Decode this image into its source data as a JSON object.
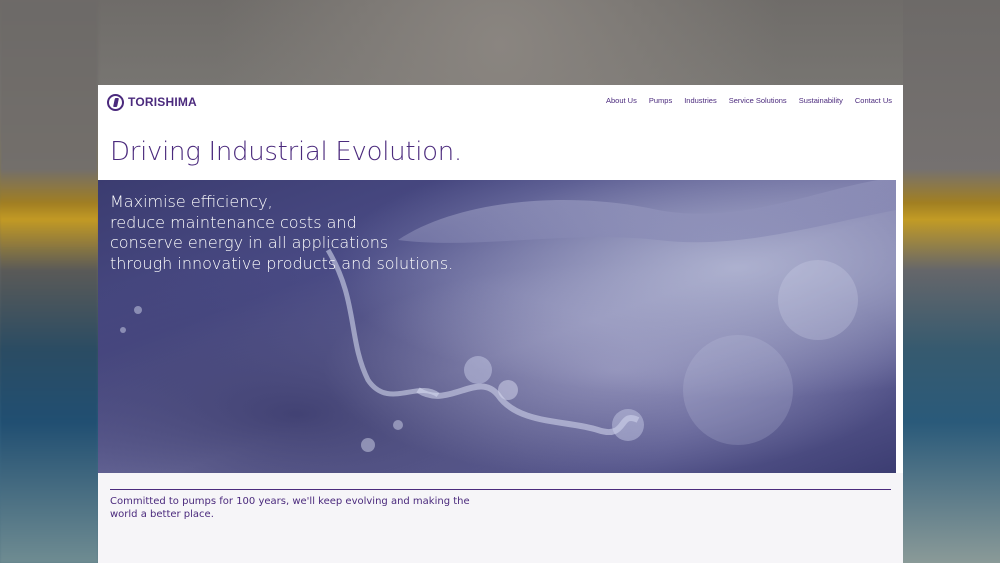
{
  "header": {
    "logo_text": "TORISHIMA",
    "nav": [
      {
        "label": "About Us"
      },
      {
        "label": "Pumps"
      },
      {
        "label": "Industries"
      },
      {
        "label": "Service Solutions"
      },
      {
        "label": "Sustainability"
      },
      {
        "label": "Contact Us"
      }
    ]
  },
  "main": {
    "headline": "Driving Industrial Evolution.",
    "hero_lines": [
      "Maximise efficiency,",
      "reduce maintenance costs and",
      "conserve energy in all applications",
      "through innovative products and solutions."
    ],
    "tagline": "Committed to pumps for 100 years, we'll keep evolving and making the world a better place."
  },
  "colors": {
    "brand": "#4b2a7d",
    "background": "#ffffff",
    "lower_band": "#f6f5f8"
  },
  "icons": {
    "logo": "torishima-logo-icon"
  }
}
